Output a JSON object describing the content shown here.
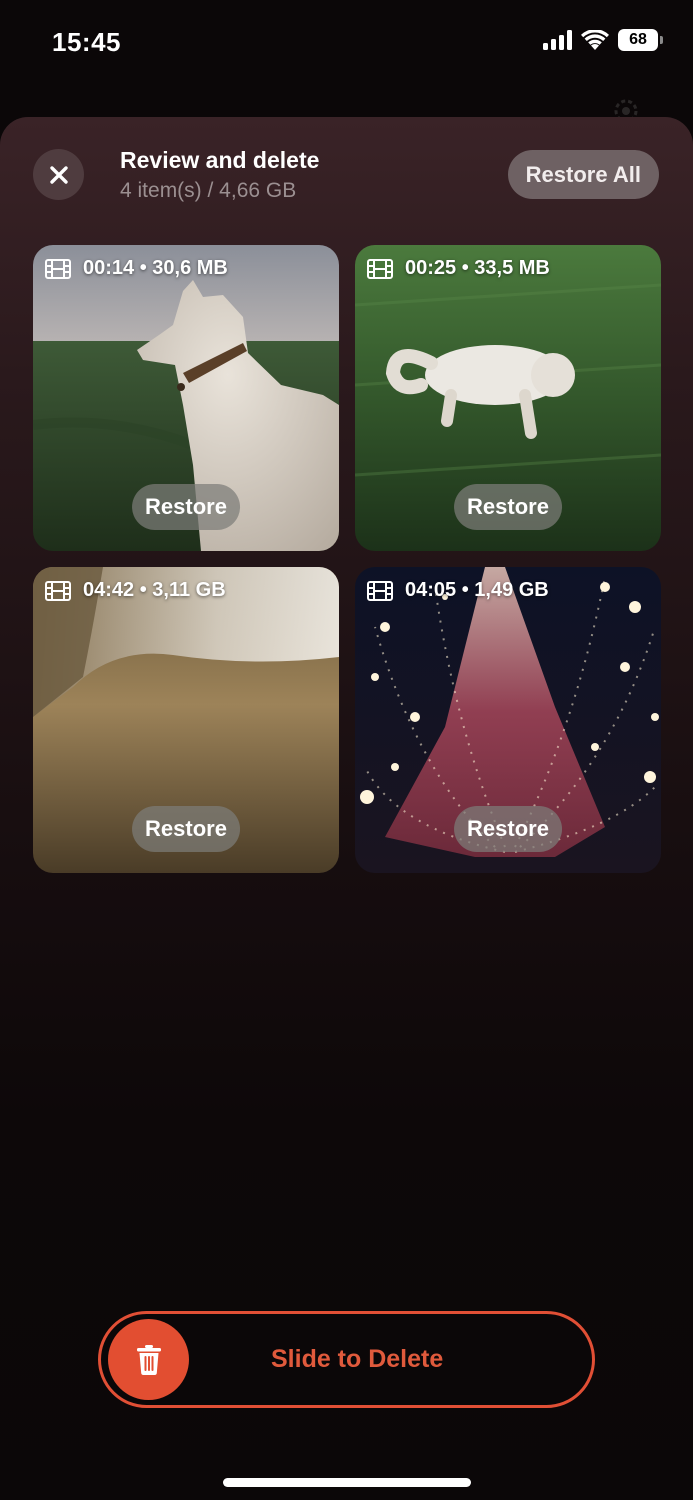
{
  "status_bar": {
    "time": "15:45",
    "battery": "68"
  },
  "header": {
    "title": "Review and delete",
    "subtitle": "4 item(s) / 4,66 GB",
    "restore_all": "Restore All"
  },
  "items": [
    {
      "duration": "00:14",
      "size": "30,6 MB",
      "meta": "00:14 • 30,6 MB",
      "restore": "Restore",
      "thumbnail": "white dog in green field"
    },
    {
      "duration": "00:25",
      "size": "33,5 MB",
      "meta": "00:25 • 33,5 MB",
      "restore": "Restore",
      "thumbnail": "white dog lying in grass"
    },
    {
      "duration": "04:42",
      "size": "3,11 GB",
      "meta": "04:42 • 3,11 GB",
      "restore": "Restore",
      "thumbnail": "blurry close-up of fur on carpet"
    },
    {
      "duration": "04:05",
      "size": "1,49 GB",
      "meta": "04:05 • 1,49 GB",
      "restore": "Restore",
      "thumbnail": "lit christmas tree with light strings"
    }
  ],
  "slide_to_delete": {
    "label": "Slide to Delete",
    "icon": "trash-icon"
  },
  "colors": {
    "accent": "#e24e31",
    "sheet_top": "#3a2327",
    "background": "#0b0708"
  }
}
